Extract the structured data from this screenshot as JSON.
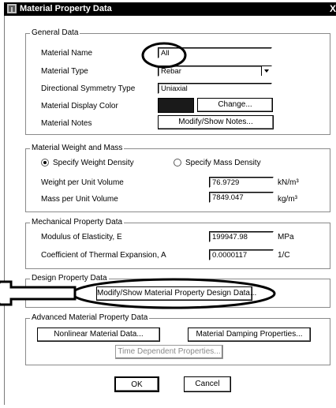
{
  "window": {
    "title": "Material Property Data",
    "close_glyph": "X"
  },
  "general": {
    "legend": "General Data",
    "material_name_label": "Material Name",
    "material_name_value": "All",
    "material_type_label": "Material Type",
    "material_type_value": "Rebar",
    "symmetry_label": "Directional Symmetry Type",
    "symmetry_value": "Uniaxial",
    "color_label": "Material Display Color",
    "color_swatch": "#1a1a1a",
    "change_button": "Change...",
    "notes_label": "Material Notes",
    "notes_button": "Modify/Show Notes..."
  },
  "weight": {
    "legend": "Material Weight and Mass",
    "radio_weight": "Specify Weight Density",
    "radio_mass": "Specify Mass Density",
    "selected": "weight",
    "weight_label": "Weight per Unit Volume",
    "weight_value": "76.9729",
    "weight_unit": "kN/m³",
    "mass_label": "Mass per Unit Volume",
    "mass_value": "7849.047",
    "mass_unit": "kg/m³"
  },
  "mechanical": {
    "legend": "Mechanical Property Data",
    "modulus_label": "Modulus of Elasticity,  E",
    "modulus_value": "199947.98",
    "modulus_unit": "MPa",
    "thermal_label": "Coefficient of Thermal Expansion,  A",
    "thermal_value": "0.0000117",
    "thermal_unit": "1/C"
  },
  "design": {
    "legend": "Design Property Data",
    "button": "Modify/Show Material Property Design Data..."
  },
  "advanced": {
    "legend": "Advanced Material Property Data",
    "nonlinear_button": "Nonlinear Material Data...",
    "damping_button": "Material Damping Properties...",
    "time_button": "Time Dependent Properties..."
  },
  "footer": {
    "ok": "OK",
    "cancel": "Cancel"
  },
  "annotation_color": "#000000"
}
